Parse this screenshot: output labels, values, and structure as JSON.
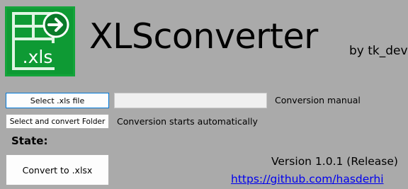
{
  "logo": {
    "text": ".xls",
    "colors": {
      "dark": "#0a7a2a",
      "mid": "#13a43a",
      "light": "#2dd24a"
    }
  },
  "app": {
    "title": "XLSconverter",
    "byline": "by tk_dev"
  },
  "controls": {
    "select_file_label": "Select .xls file",
    "file_path_value": "",
    "conversion_manual_label": "Conversion manual",
    "convert_folder_label": "Select and convert Folder",
    "conversion_auto_label": "Conversion starts automatically",
    "state_label": "State:",
    "convert_button_label": "Convert to .xlsx"
  },
  "footer": {
    "version": "Version 1.0.1 (Release)",
    "repo_link": "https://github.com/hasderhi"
  },
  "colors": {
    "background": "#aaaaaa",
    "link": "#0000ee",
    "focus_border": "#0078d7"
  }
}
